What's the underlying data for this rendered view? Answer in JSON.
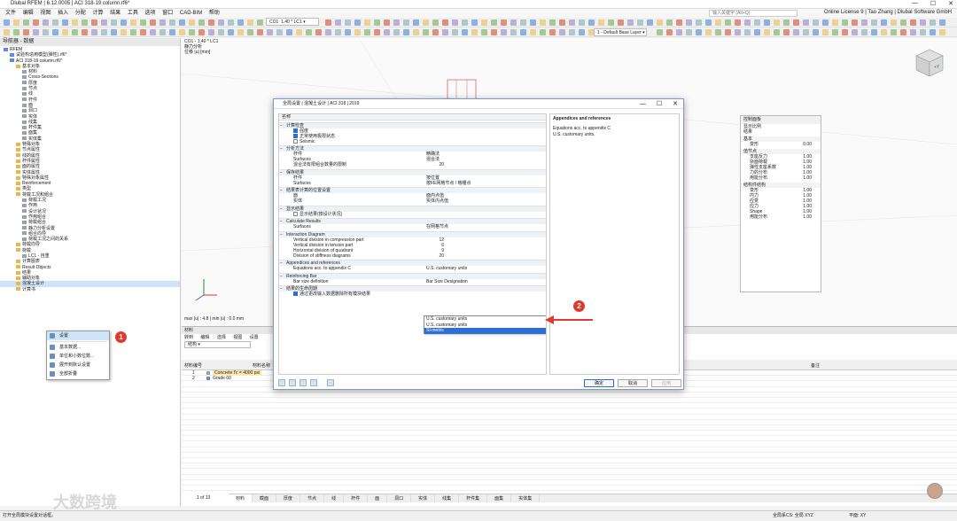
{
  "window": {
    "title": "Dlubal RFEM | 6.12.0005 | ACI 318-19 column.rf6*",
    "controls": [
      "—",
      "☐",
      "✕"
    ]
  },
  "menu": [
    "文件",
    "编辑",
    "视图",
    "插入",
    "分配",
    "计算",
    "结果",
    "工具",
    "选项",
    "窗口",
    "CAD-BIM",
    "帮助"
  ],
  "search_placeholder": "输入关键字 (Alt+Q)",
  "license": "Online License 9 | Tao Zhang | Dlubal Software GmbH",
  "load_case": {
    "code": "CO1",
    "label": "1.40 * LC1"
  },
  "layer": "1 - Default Base Layer",
  "navigator": {
    "title": "导航器 - 数据",
    "rows": [
      {
        "indent": 0,
        "text": "RFEM",
        "icon": "blue"
      },
      {
        "indent": 1,
        "text": "试验构造用模型(弹性).rf6*",
        "icon": "blue"
      },
      {
        "indent": 1,
        "text": "ACI 318-19 column.rf6*",
        "icon": "blue"
      },
      {
        "indent": 2,
        "text": "基本对象",
        "icon": "folder"
      },
      {
        "indent": 3,
        "text": "材料",
        "icon": "gray"
      },
      {
        "indent": 3,
        "text": "Cross-Sections",
        "icon": "gray"
      },
      {
        "indent": 3,
        "text": "厚度",
        "icon": "gray"
      },
      {
        "indent": 3,
        "text": "节点",
        "icon": "gray"
      },
      {
        "indent": 3,
        "text": "线",
        "icon": "gray"
      },
      {
        "indent": 3,
        "text": "杆件",
        "icon": "gray"
      },
      {
        "indent": 3,
        "text": "面",
        "icon": "gray"
      },
      {
        "indent": 3,
        "text": "洞口",
        "icon": "gray"
      },
      {
        "indent": 3,
        "text": "实体",
        "icon": "gray"
      },
      {
        "indent": 3,
        "text": "线集",
        "icon": "gray"
      },
      {
        "indent": 3,
        "text": "杆件集",
        "icon": "gray"
      },
      {
        "indent": 3,
        "text": "面集",
        "icon": "gray"
      },
      {
        "indent": 3,
        "text": "实体集",
        "icon": "gray"
      },
      {
        "indent": 2,
        "text": "特殊对象",
        "icon": "folder"
      },
      {
        "indent": 2,
        "text": "节点属性",
        "icon": "folder"
      },
      {
        "indent": 2,
        "text": "线的属性",
        "icon": "folder"
      },
      {
        "indent": 2,
        "text": "杆件属性",
        "icon": "folder"
      },
      {
        "indent": 2,
        "text": "面的属性",
        "icon": "folder"
      },
      {
        "indent": 2,
        "text": "实体属性",
        "icon": "folder"
      },
      {
        "indent": 2,
        "text": "特殊对象属性",
        "icon": "folder"
      },
      {
        "indent": 2,
        "text": "Reinforcement",
        "icon": "folder"
      },
      {
        "indent": 2,
        "text": "类型",
        "icon": "folder"
      },
      {
        "indent": 2,
        "text": "荷载工况和组合",
        "icon": "folder"
      },
      {
        "indent": 3,
        "text": "荷载工况",
        "icon": "gray"
      },
      {
        "indent": 3,
        "text": "作用",
        "icon": "gray"
      },
      {
        "indent": 3,
        "text": "设计状况",
        "icon": "gray"
      },
      {
        "indent": 3,
        "text": "作用组合",
        "icon": "gray"
      },
      {
        "indent": 3,
        "text": "荷载组合",
        "icon": "gray"
      },
      {
        "indent": 3,
        "text": "静力分析设置",
        "icon": "gray"
      },
      {
        "indent": 3,
        "text": "组合向导",
        "icon": "gray"
      },
      {
        "indent": 3,
        "text": "荷载工况之间的关系",
        "icon": "gray"
      },
      {
        "indent": 2,
        "text": "荷载向导",
        "icon": "folder"
      },
      {
        "indent": 2,
        "text": "荷载",
        "icon": "folder"
      },
      {
        "indent": 3,
        "text": "LC1 - 自重",
        "icon": "gray"
      },
      {
        "indent": 2,
        "text": "计算图表",
        "icon": "folder"
      },
      {
        "indent": 2,
        "text": "Result Objects",
        "icon": "folder"
      },
      {
        "indent": 2,
        "text": "结果",
        "icon": "folder"
      },
      {
        "indent": 2,
        "text": "辅助对象",
        "icon": "folder"
      },
      {
        "indent": 2,
        "text": "混凝土设计",
        "icon": "folder"
      },
      {
        "indent": 2,
        "text": "计算书",
        "icon": "folder"
      }
    ]
  },
  "context_menu": {
    "items": [
      "设置",
      "基本数据...",
      "单位和小数位数...",
      "展开到默认设置",
      "全部折叠"
    ],
    "badge": "1"
  },
  "viewport": {
    "info_lines": [
      "CO1 - 1.40 * LC1",
      "静力分析",
      "位移 |u| [mm]"
    ],
    "minmax": "max |u| : 4.8 | min |u| : 0.0 mm"
  },
  "control_panel": {
    "title": "控制面板",
    "subtitle": "显示比例",
    "sub2": "结果",
    "sections": [
      {
        "name": "基本",
        "rows": [
          {
            "label": "变形",
            "value": "0.00"
          }
        ]
      },
      {
        "name": "值节点",
        "rows": [
          {
            "label": "支座反力",
            "value": "1.00"
          },
          {
            "label": "杂面荷载",
            "value": "1.00"
          },
          {
            "label": "弹性支座系数",
            "value": "1.00"
          },
          {
            "label": "力的分布",
            "value": "1.00"
          },
          {
            "label": "用能分布",
            "value": "1.00"
          }
        ]
      },
      {
        "name": "结构件结构",
        "rows": [
          {
            "label": "变形",
            "value": "1.00"
          },
          {
            "label": "内力",
            "value": "1.00"
          },
          {
            "label": "应变",
            "value": "1.00"
          },
          {
            "label": "应力",
            "value": "1.00"
          },
          {
            "label": "Shape",
            "value": "1.00"
          },
          {
            "label": "用能分布",
            "value": "1.00"
          }
        ]
      }
    ]
  },
  "materials": {
    "title": "材料",
    "menu": [
      "转到",
      "编辑",
      "选择",
      "视图",
      "设置"
    ],
    "combo": "结构",
    "col_headers": [
      "材料编号",
      "材料名称",
      "备注"
    ],
    "rows": [
      {
        "no": "1",
        "name": "Concrete f'c = 4000 psi"
      },
      {
        "no": "2",
        "name": "Grade 60"
      }
    ],
    "pager": "1 of 13"
  },
  "bottom_tabs": [
    "材料",
    "截面",
    "厚度",
    "节点",
    "线",
    "杆件",
    "面",
    "洞口",
    "实体",
    "线集",
    "杆件集",
    "面集",
    "实体集"
  ],
  "status": {
    "left": "打开全局模块设置对话框。",
    "coord": "全局系CS: 全局 XYZ",
    "plane": "平面: XY"
  },
  "dialog": {
    "title": "全局设置 | 混凝土设计 | ACI 318 | 2019",
    "col_header": "名称",
    "groups": [
      {
        "name": "计算检查",
        "rows": [
          {
            "type": "check",
            "on": true,
            "label": "强度"
          },
          {
            "type": "check",
            "on": true,
            "label": "正常使用极限状态"
          },
          {
            "type": "check",
            "on": false,
            "label": "Seismic"
          }
        ]
      },
      {
        "name": "分析方法",
        "rows": [
          {
            "type": "val",
            "label": "杆件",
            "value": "精确法"
          },
          {
            "type": "val",
            "label": "Surfaces",
            "value": "混合法"
          },
          {
            "type": "num",
            "label": "混合法有限组合数量的限制",
            "value": "20"
          }
        ]
      },
      {
        "name": "保存结果",
        "rows": [
          {
            "type": "val",
            "label": "杆件",
            "value": "按位置"
          },
          {
            "type": "val",
            "label": "Surfaces",
            "value": "按FE网格节点 / 格栅点"
          }
        ]
      },
      {
        "name": "结果表计算的位置设置",
        "rows": [
          {
            "type": "val",
            "label": "面",
            "value": "面内点值"
          },
          {
            "type": "val",
            "label": "实体",
            "value": "实体内点值"
          }
        ]
      },
      {
        "name": "显示结果",
        "rows": [
          {
            "type": "check",
            "on": false,
            "label": "显示结果(按设计状况)"
          }
        ]
      },
      {
        "name": "Calculate Results",
        "rows": [
          {
            "type": "val",
            "label": "Surfaces",
            "value": "在网格节点"
          }
        ]
      },
      {
        "name": "Interaction Diagram",
        "rows": [
          {
            "type": "num",
            "label": "Vertical division in compression part",
            "value": "12"
          },
          {
            "type": "num",
            "label": "Vertical division in tension part",
            "value": "6"
          },
          {
            "type": "num",
            "label": "Horizontal division of quadrant",
            "value": "9"
          },
          {
            "type": "num",
            "label": "Division of stiffness diagrams",
            "value": "20"
          }
        ]
      },
      {
        "name": "Appendices and references",
        "rows": [
          {
            "type": "val",
            "label": "Equations acc. to appendix C",
            "value": "U.S. customary units"
          }
        ]
      },
      {
        "name": "Reinforcing Bar",
        "rows": [
          {
            "type": "val",
            "label": "Bar size definition",
            "value": "Bar Size Designation"
          }
        ]
      },
      {
        "name": "结果的生命周期",
        "rows": [
          {
            "type": "check",
            "on": true,
            "label": "通过更改输入数据删除所有模块结果"
          }
        ]
      }
    ],
    "dropdown_options": [
      "U.S. customary units",
      "SI-metric"
    ],
    "dropdown_selected": 1,
    "help": {
      "heading": "Appendices and references",
      "lines": [
        "Equations acc. to appendix C",
        "U.S. customary units."
      ]
    },
    "buttons": {
      "ok": "确定",
      "cancel": "取消",
      "apply": "应用"
    },
    "badge": "2"
  },
  "watermark": "大数跨境",
  "colors": {
    "accent": "#2b6fd1",
    "badge": "#e03a2e",
    "arrow": "#e03a2e"
  }
}
